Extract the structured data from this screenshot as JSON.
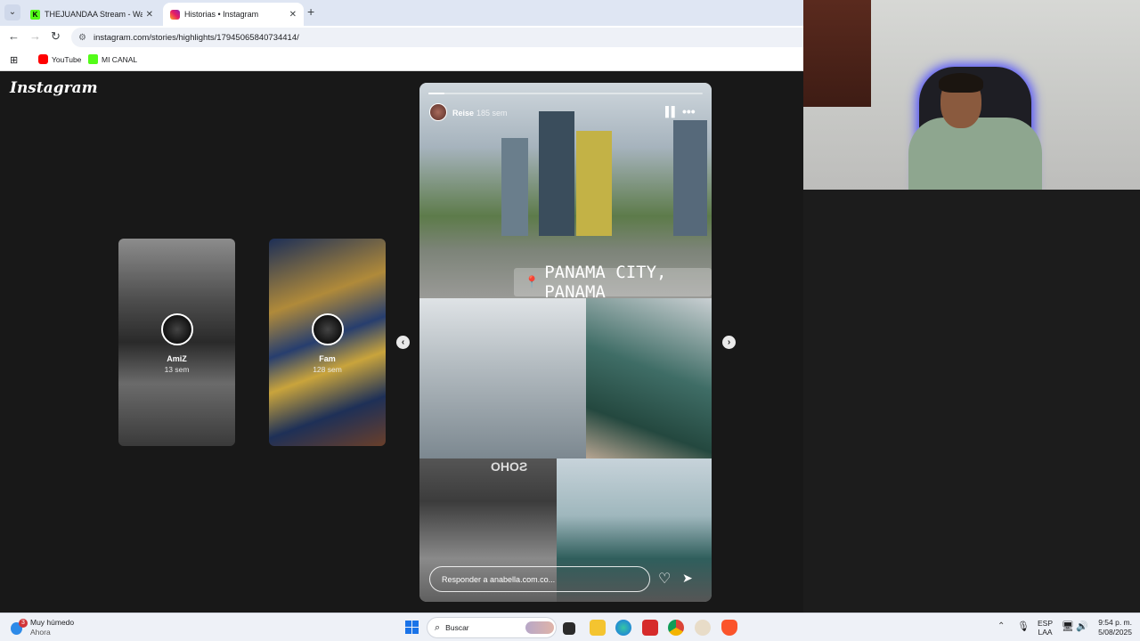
{
  "browser": {
    "tabs": [
      {
        "title": "THEJUANDAA Stream - Watch",
        "favicon": "kick-icon"
      },
      {
        "title": "Historias • Instagram",
        "favicon": "instagram-icon",
        "active": true
      }
    ],
    "url": "instagram.com/stories/highlights/17945065840734414/",
    "bookmarks": [
      {
        "label": "YouTube",
        "icon": "youtube-icon"
      },
      {
        "label": "MI CANAL",
        "icon": "kick-icon"
      }
    ]
  },
  "instagram": {
    "logo": "Instagram",
    "highlights": [
      {
        "name": "AmiZ",
        "time": "13 sem"
      },
      {
        "name": "Fam",
        "time": "128 sem"
      }
    ],
    "story": {
      "username": "Reise",
      "time": "185 sem",
      "location": "PANAMA CITY, PANAMA",
      "sign_text": "SOHO",
      "reply_placeholder": "Responder a anabella.com.co...",
      "progress": 0.06
    }
  },
  "taskbar": {
    "weather_badge": "3",
    "weather_title": "Muy húmedo",
    "weather_sub": "Ahora",
    "search_placeholder": "Buscar",
    "lang_top": "ESP",
    "lang_bottom": "LAA",
    "time": "9:54 p. m.",
    "date": "5/08/2025"
  },
  "colors": {
    "accent_blue": "#1a73e8",
    "instagram_bg": "#181818",
    "kick_green": "#53fc18",
    "youtube_red": "#ff0000"
  }
}
